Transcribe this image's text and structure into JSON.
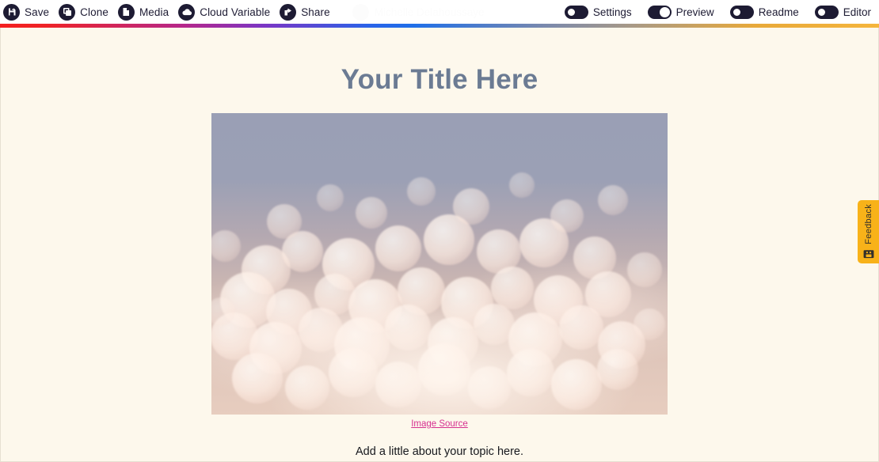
{
  "toolbar": {
    "actions": [
      {
        "label": "Save",
        "icon": "save-icon"
      },
      {
        "label": "Clone",
        "icon": "clone-icon"
      },
      {
        "label": "Media",
        "icon": "file-icon"
      },
      {
        "label": "Cloud Variable",
        "icon": "cloud-icon"
      },
      {
        "label": "Share",
        "icon": "share-icon"
      }
    ],
    "user": {
      "name": "Michelle Delahoussaye",
      "avatar": "avatar"
    },
    "toggles": [
      {
        "label": "Settings",
        "state": "off"
      },
      {
        "label": "Preview",
        "state": "on"
      },
      {
        "label": "Readme",
        "state": "off"
      },
      {
        "label": "Editor",
        "state": "off"
      }
    ]
  },
  "accent_bar": {
    "colors": [
      "#f41f1f",
      "#b5278b",
      "#7b35c4",
      "#2a63e8",
      "#7a89ad",
      "#e8a93a"
    ]
  },
  "page": {
    "background": "#fdf8ec",
    "title": "Your Title Here",
    "title_color": "#6b7b93",
    "image": {
      "alt": "blurred bokeh lights photo",
      "caption_link": "Image Source",
      "caption_link_color": "#d6308f"
    },
    "body_text": "Add a little about your topic here."
  },
  "feedback_tab": {
    "label": "Feedback",
    "color": "#f8b219",
    "icon": "feedback-smiley-icon"
  }
}
